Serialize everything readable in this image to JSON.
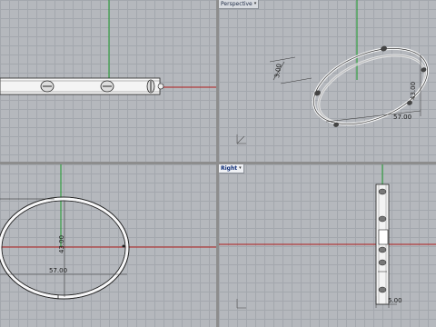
{
  "viewports": {
    "top": {
      "title": ""
    },
    "perspective": {
      "title": "Perspective"
    },
    "front": {
      "title": ""
    },
    "right": {
      "title": "Right"
    }
  },
  "dimensions": {
    "persp_height": "3.00",
    "persp_diameter": "57.00",
    "persp_depth": "43.00",
    "front_width": "57.00",
    "front_height": "43.00",
    "right_width": "5.00"
  },
  "colors": {
    "grid_bg": "#b5b8bd",
    "axis_x": "#b01c1c",
    "axis_y": "#1c9a2a",
    "model": "#ffffff"
  }
}
